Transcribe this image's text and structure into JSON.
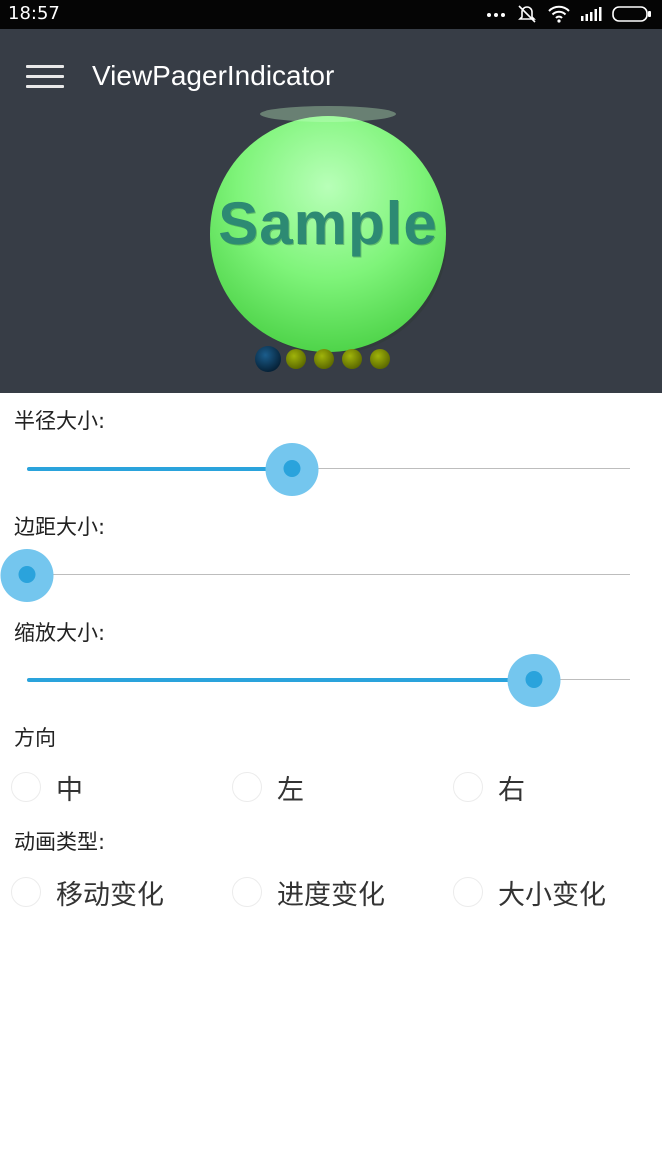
{
  "status_bar": {
    "time": "18:57",
    "icons": [
      "more-dots-icon",
      "mute-icon",
      "wifi-icon",
      "signal-icon",
      "battery-icon"
    ]
  },
  "app_bar": {
    "title": "ViewPagerIndicator",
    "menu_icon": "hamburger-menu-icon",
    "background": "#373d46"
  },
  "pager": {
    "image_text": "Sample",
    "indicator_count": 5,
    "selected_index": 0
  },
  "sliders": [
    {
      "label": "半径大小:",
      "value": 0.44
    },
    {
      "label": "边距大小:",
      "value": 0.0
    },
    {
      "label": "缩放大小:",
      "value": 0.84
    }
  ],
  "direction": {
    "label": "方向",
    "options": [
      "中",
      "左",
      "右"
    ]
  },
  "animation": {
    "label": "动画类型:",
    "options": [
      "移动变化",
      "进度变化",
      "大小变化"
    ]
  },
  "colors": {
    "accent": "#2aa3dc",
    "accent_halo": "#74c6ee"
  }
}
